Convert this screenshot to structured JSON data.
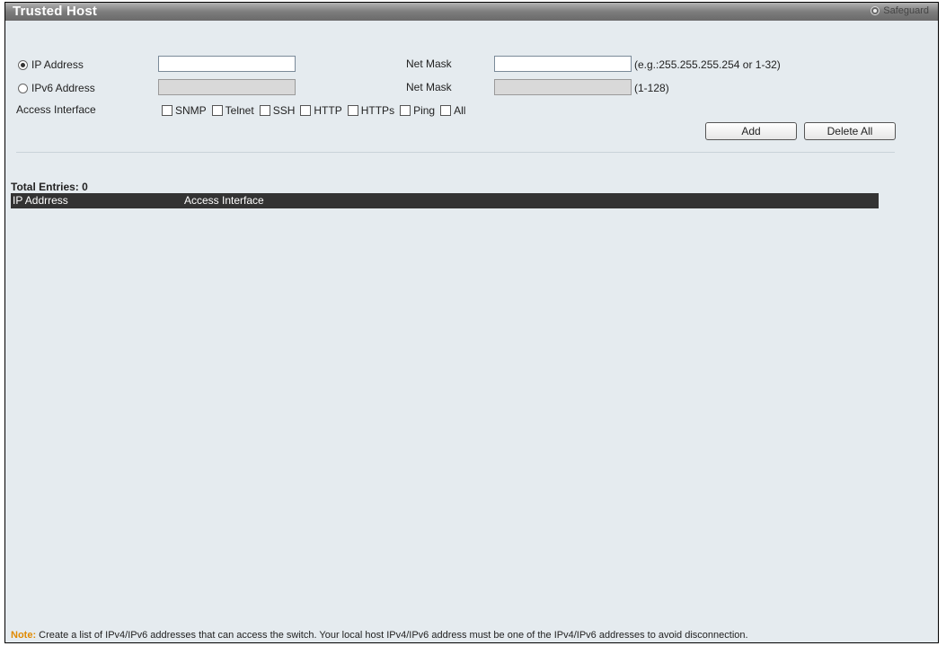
{
  "header": {
    "title": "Trusted Host",
    "safeguard_label": "Safeguard"
  },
  "form": {
    "ip_address_label": "IP Address",
    "ip_address_value": "",
    "ipv6_address_label": "IPv6 Address",
    "ipv6_address_value": "",
    "net_mask_label": "Net Mask",
    "net_mask_value": "",
    "net_mask_hint": "(e.g.:255.255.255.254 or 1-32)",
    "net_mask_v6_label": "Net Mask",
    "net_mask_v6_value": "",
    "net_mask_v6_hint": "(1-128)",
    "access_interface_label": "Access Interface",
    "interfaces": [
      "SNMP",
      "Telnet",
      "SSH",
      "HTTP",
      "HTTPs",
      "Ping",
      "All"
    ],
    "selected_mode": "IP Address"
  },
  "buttons": {
    "add": "Add",
    "delete_all": "Delete All"
  },
  "table": {
    "total_entries_label": "Total Entries: 0",
    "columns": [
      "IP Addrress",
      "Access Interface"
    ]
  },
  "note": {
    "label": "Note:",
    "text": "Create a list of IPv4/IPv6 addresses that can access the switch. Your local host IPv4/IPv6 address must be one of the IPv4/IPv6 addresses to avoid disconnection."
  },
  "colors": {
    "title_bar": "#7d7d7d",
    "panel_bg": "#e5ebef",
    "table_header": "#333333",
    "note_label": "#e08a00"
  }
}
